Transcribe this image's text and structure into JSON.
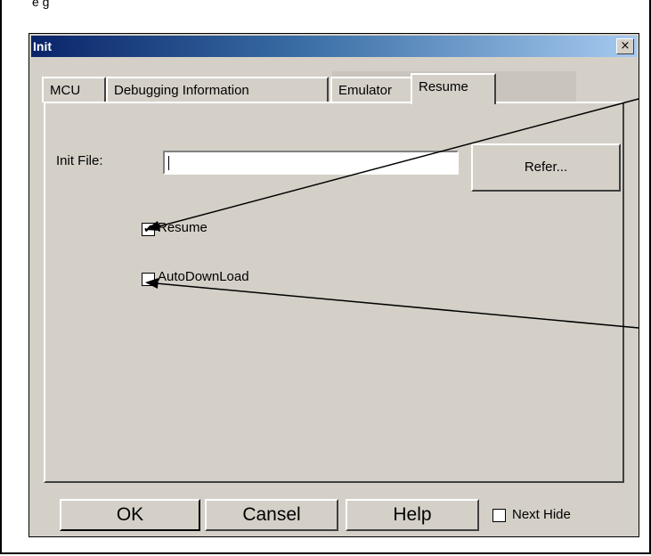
{
  "dialog": {
    "title": "Init",
    "close_glyph": "×"
  },
  "tabs": [
    {
      "label": "MCU",
      "active": false
    },
    {
      "label": "Debugging Information",
      "active": false
    },
    {
      "label": "Emulator",
      "active": false
    },
    {
      "label": "Resume",
      "active": true
    }
  ],
  "resume_panel": {
    "init_file_label": "Init File:",
    "init_file_value": "",
    "refer_button_label": "Refer...",
    "resume_checkbox": {
      "label": "Resume",
      "checked": true,
      "glyph": "✔"
    },
    "autodownload_checkbox": {
      "label": "AutoDownLoad",
      "checked": false
    }
  },
  "footer": {
    "ok_label": "OK",
    "cancel_label": "Cansel",
    "help_label": "Help",
    "next_hide_label": "Next Hide",
    "next_hide_checked": false
  },
  "colors": {
    "title_gradient_start": "#0a246a",
    "title_gradient_end": "#a6caf0",
    "dialog_face": "#d4d0c8"
  },
  "icons": {
    "close": "close-icon",
    "check": "check-icon",
    "annotation_arrow": "arrow-icon"
  }
}
